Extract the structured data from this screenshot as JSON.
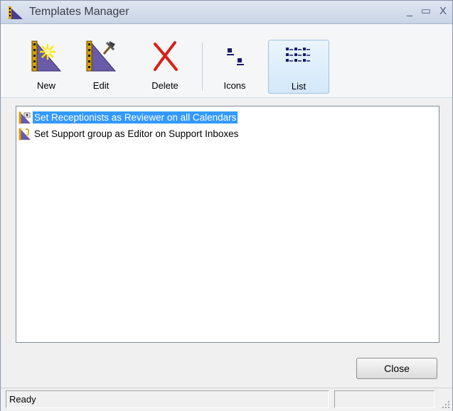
{
  "window": {
    "title": "Templates Manager",
    "minimize": "_",
    "maximize": "▭",
    "close": "X"
  },
  "toolbar": {
    "new_label": "New",
    "edit_label": "Edit",
    "delete_label": "Delete",
    "icons_label": "Icons",
    "list_label": "List"
  },
  "templates": [
    {
      "label": "Set Receptionists as Reviewer on all Calendars",
      "selected": true
    },
    {
      "label": "Set Support group as Editor on Support Inboxes",
      "selected": false
    }
  ],
  "buttons": {
    "close_label": "Close"
  },
  "status": {
    "text": "Ready"
  },
  "colors": {
    "selection": "#3399ff",
    "icon_blue": "#6a5ba8",
    "delete_red": "#e02020"
  }
}
